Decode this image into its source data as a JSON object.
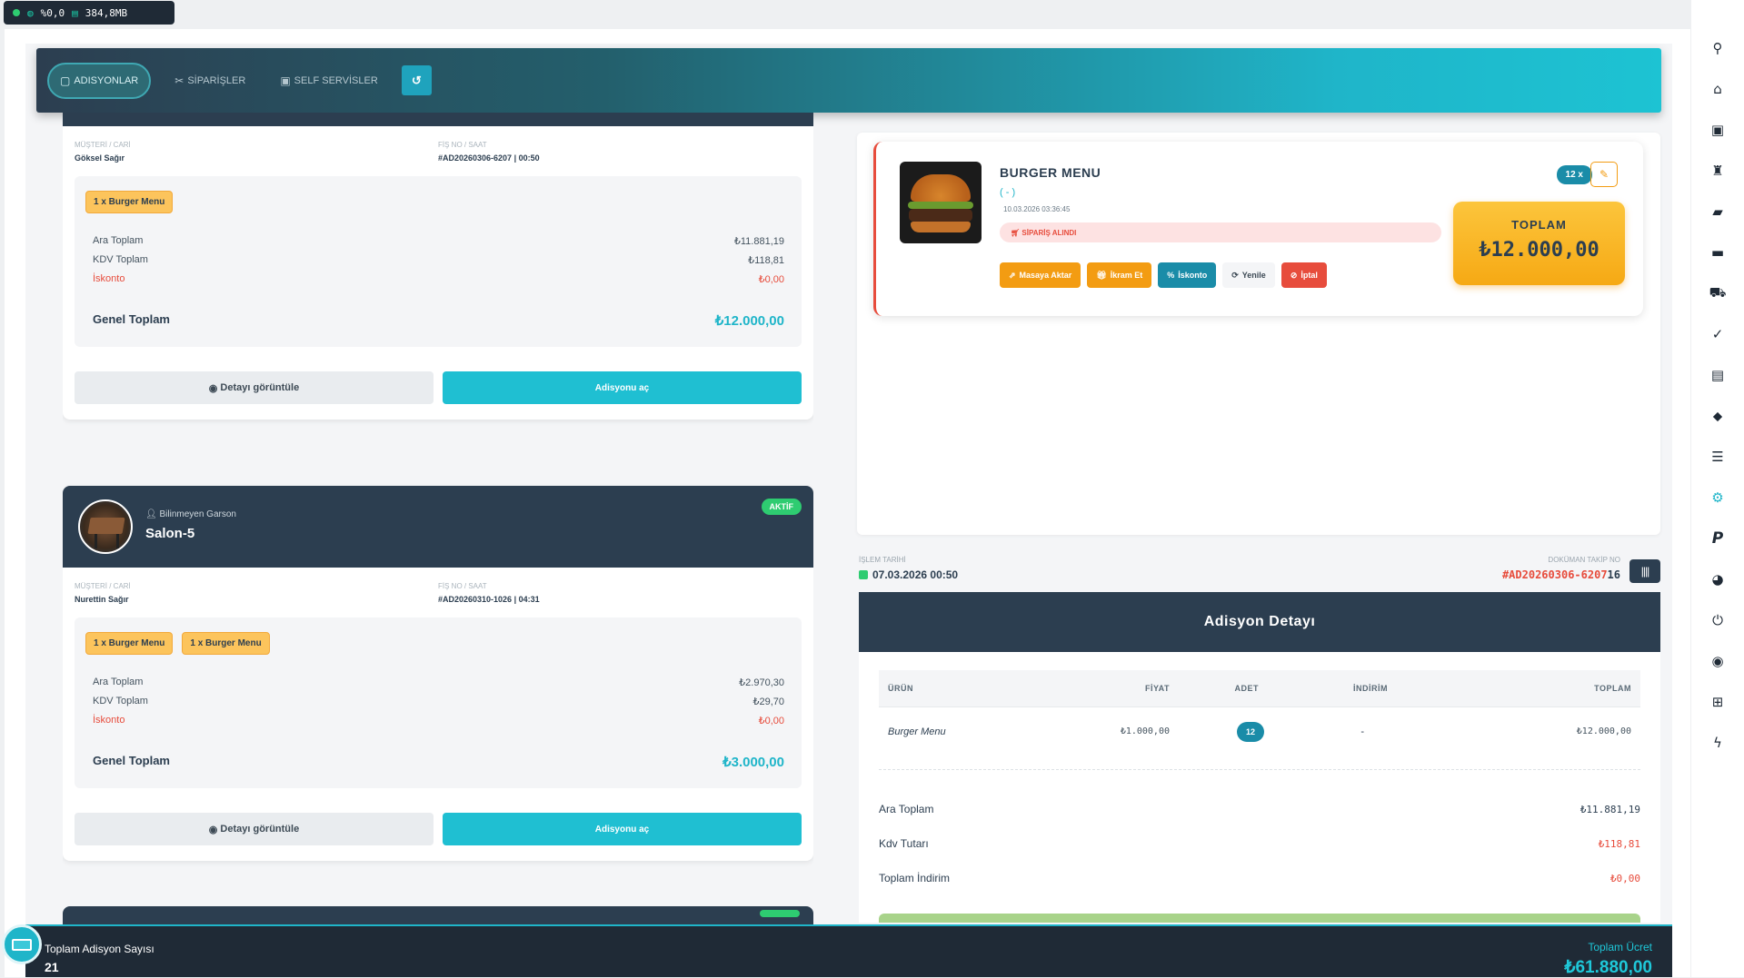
{
  "system": {
    "cpu": "%0,0",
    "mem": "384,8MB"
  },
  "tabs": [
    {
      "label": "ADISYONLAR",
      "icon": "clipboard-icon"
    },
    {
      "label": "SİPARİŞLER",
      "icon": "utensils-icon"
    },
    {
      "label": "SELF SERVİSLER",
      "icon": "coffee-icon"
    }
  ],
  "refresh_label": "↺",
  "cards": [
    {
      "waiter": "",
      "table": "",
      "status": "",
      "customer_label": "MÜŞTERİ / CARİ",
      "customer": "Göksel Sağır",
      "receipt_label": "FİŞ NO / SAAT",
      "receipt": "#AD20260306-6207 | 00:50",
      "items": [
        "1 x Burger Menu"
      ],
      "subtotal_label": "Ara Toplam",
      "subtotal": "₺11.881,19",
      "vat_label": "KDV Toplam",
      "vat": "₺118,81",
      "discount_label": "İskonto",
      "discount": "₺0,00",
      "grand_label": "Genel Toplam",
      "grand": "₺12.000,00",
      "detail_btn": "Detayı görüntüle",
      "open_btn": "Adisyonu aç"
    },
    {
      "waiter": "Bilinmeyen Garson",
      "table": "Salon-5",
      "status": "AKTİF",
      "customer_label": "MÜŞTERİ / CARİ",
      "customer": "Nurettin Sağır",
      "receipt_label": "FİŞ NO / SAAT",
      "receipt": "#AD20260310-1026 | 04:31",
      "items": [
        "1 x Burger Menu",
        "1 x Burger Menu"
      ],
      "subtotal_label": "Ara Toplam",
      "subtotal": "₺2.970,30",
      "vat_label": "KDV Toplam",
      "vat": "₺29,70",
      "discount_label": "İskonto",
      "discount": "₺0,00",
      "grand_label": "Genel Toplam",
      "grand": "₺3.000,00",
      "detail_btn": "Detayı görüntüle",
      "open_btn": "Adisyonu aç"
    }
  ],
  "product": {
    "name": "BURGER MENU",
    "sub": "( - )",
    "date": "10.03.2026 03:36:45",
    "status": "SİPARİŞ ALINDI",
    "qty": "12 x",
    "total_label": "TOPLAM",
    "total": "₺12.000,00",
    "actions": [
      "Masaya Aktar",
      "İkram Et",
      "İskonto",
      "Yenile",
      "İptal"
    ]
  },
  "info": {
    "date_label": "İŞLEM TARİHİ",
    "date": "07.03.2026 00:50",
    "doc_label": "DOKÜMAN TAKİP NO",
    "doc_red": "#AD20260306-6207",
    "doc_rest": "16"
  },
  "detail": {
    "title": "Adisyon Detayı",
    "headers": [
      "ÜRÜN",
      "FİYAT",
      "ADET",
      "İNDİRİM",
      "TOPLAM"
    ],
    "row": {
      "product": "Burger Menu",
      "price": "₺1.000,00",
      "qty": "12",
      "discount": "-",
      "total": "₺12.000,00"
    },
    "subtotal_label": "Ara Toplam",
    "subtotal": "₺11.881,19",
    "vat_label": "Kdv Tutarı",
    "vat": "₺118,81",
    "discount_label": "Toplam İndirim",
    "discount": "₺0,00"
  },
  "footer": {
    "count_label": "Toplam Adisyon Sayısı",
    "count": "21",
    "total_label": "Toplam Ücret",
    "total": "₺61.880,00"
  },
  "rail_icons": [
    "search-icon",
    "home-icon",
    "id-card-icon",
    "wine-icon",
    "briefcase-icon",
    "folder-user-icon",
    "cart-icon",
    "clipboard-check-icon",
    "document-icon",
    "tag-icon",
    "receipt-icon",
    "settings-icon",
    "parking-icon",
    "palette-icon",
    "power-icon",
    "globe-icon",
    "first-aid-icon",
    "bolt-icon"
  ]
}
